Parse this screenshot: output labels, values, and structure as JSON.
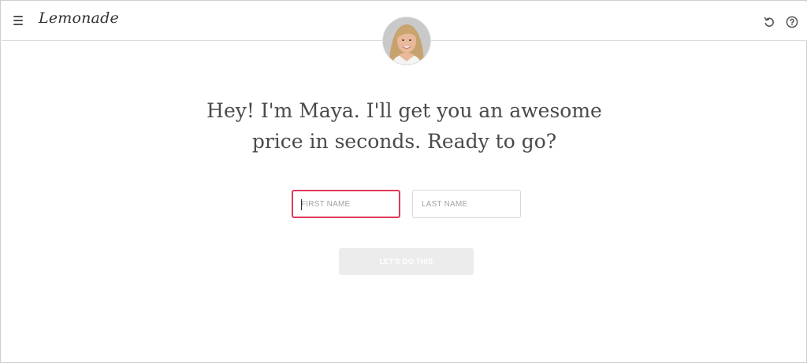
{
  "header": {
    "brand": "Lemonade",
    "icons": {
      "menu": "menu-icon",
      "undo": "undo-icon",
      "help": "help-icon"
    }
  },
  "avatar": {
    "name": "Maya",
    "icon": "person-photo"
  },
  "main": {
    "headline_line1": "Hey! I'm Maya. I'll get you an awesome",
    "headline_line2": "price in seconds. Ready to go?",
    "first_name": {
      "placeholder": "FIRST NAME",
      "value": ""
    },
    "last_name": {
      "placeholder": "LAST NAME",
      "value": ""
    },
    "cta_label": "LET'S DO THIS"
  },
  "colors": {
    "accent": "#e0395c",
    "button_disabled": "#ececec",
    "text": "#4a4a4a"
  }
}
